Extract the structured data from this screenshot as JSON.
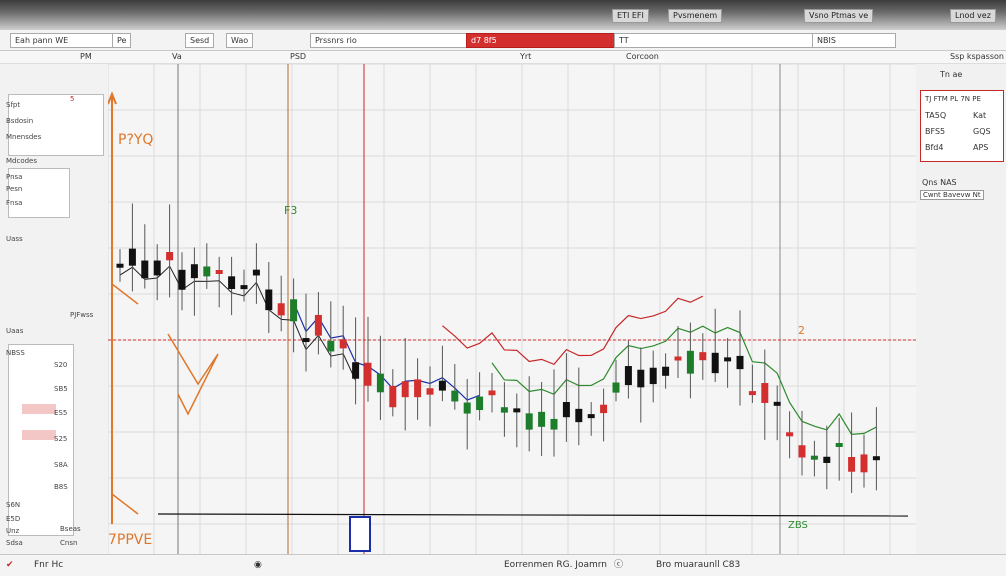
{
  "titlebar": {
    "chip1": "ETI EFI",
    "chip2": "Pvsmenem",
    "chip3": "Vsno Ptmas ve",
    "chip4": "Lnod vez"
  },
  "toolbar": {
    "symbol_field": "Eah pann WE",
    "item2": "Pe",
    "item3": "Sesd",
    "item4": "Wao",
    "item5": "Prssnrs rio",
    "item6": "d7 8f5",
    "item7": "TT",
    "item8": "NBIS"
  },
  "menubar": {
    "m1": "PM",
    "m2": "Va",
    "m3": "PSD",
    "m4": "Yrt",
    "m5": "Corcoon",
    "m6": "Ssp kspasson"
  },
  "left_panel": {
    "rows": [
      "Sfpt",
      "Bsdosin",
      "Mnensdes",
      "Mdcodes",
      "Pnsa",
      "Pesn",
      "Fnsa",
      "Uass",
      "PJFwss",
      "Uaas",
      "NBSS",
      "S20",
      "SB5",
      "ES5",
      "S25",
      "S8A",
      "B8S",
      "S6N",
      "E5D",
      "Unz",
      "Sdsa",
      "Bseas",
      "Cnsn"
    ],
    "badge": "5"
  },
  "chart": {
    "top_note": "P?YQ",
    "level_label": "2",
    "bottom_label": "7PPVE",
    "gauge_label": "F3",
    "gauge_label2": "ZBS"
  },
  "right_panel": {
    "header": "Tn ae",
    "quote_title": "TJ FTM PL 7N PE",
    "quotes": [
      {
        "label": "TA5Q",
        "value": "Kat"
      },
      {
        "label": "BFS5",
        "value": "GQS"
      },
      {
        "label": "Bfd4",
        "value": "APS"
      }
    ],
    "sub1": "Qns NAS",
    "sub2": "Cwnt Bavevw Nt"
  },
  "statusbar": {
    "left": "Fnr Hc",
    "mid": "Eorrenmen RG. Joamrn",
    "right": "Bro muaraunll C83"
  },
  "colors": {
    "bull": "#1e7d2b",
    "bear": "#d32f2f",
    "doji": "#111111",
    "accent": "#c62828"
  }
}
